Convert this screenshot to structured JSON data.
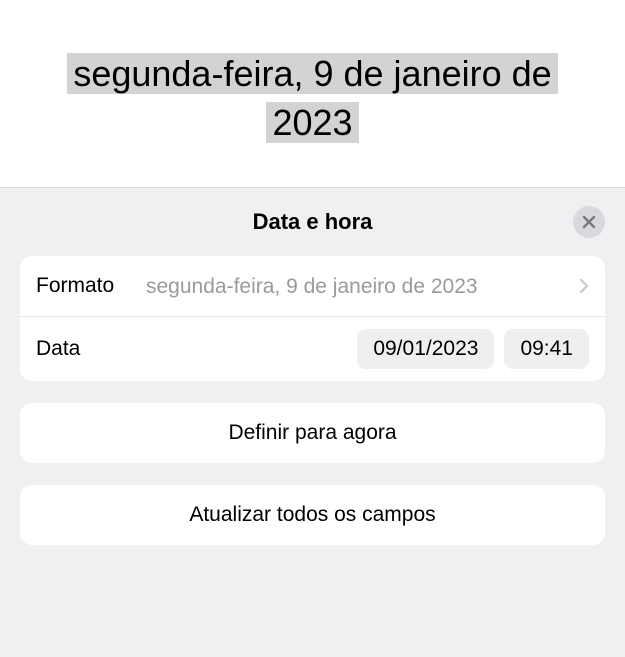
{
  "preview": {
    "text": "segunda-feira, 9 de janeiro de 2023"
  },
  "panel": {
    "title": "Data e hora",
    "format": {
      "label": "Formato",
      "value": "segunda-feira, 9 de janeiro de 2023"
    },
    "date": {
      "label": "Data",
      "dateValue": "09/01/2023",
      "timeValue": "09:41"
    },
    "buttons": {
      "setNow": "Definir para agora",
      "updateAll": "Atualizar todos os campos"
    }
  }
}
